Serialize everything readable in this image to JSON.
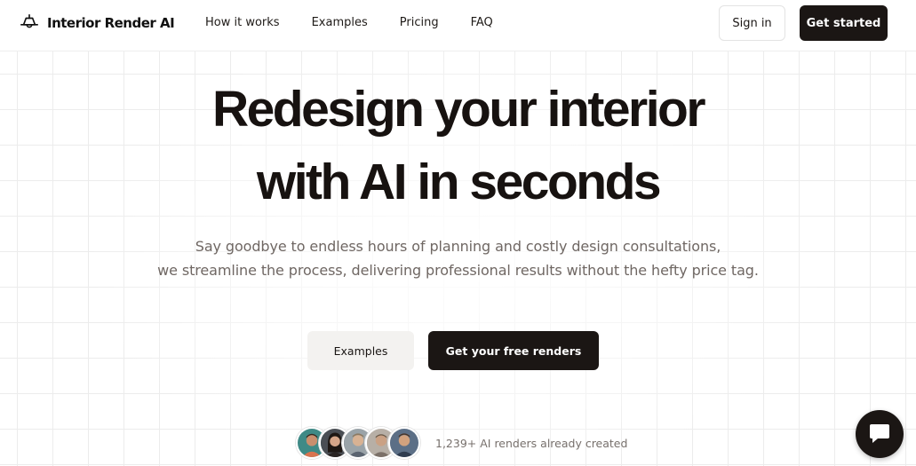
{
  "brand": {
    "name": "Interior Render AI",
    "icon": "lamp-icon"
  },
  "nav": {
    "items": [
      "How it works",
      "Examples",
      "Pricing",
      "FAQ"
    ]
  },
  "header_actions": {
    "signin_label": "Sign in",
    "get_started_label": "Get started"
  },
  "hero": {
    "title_line1": "Redesign your interior",
    "title_line2": "with AI in seconds",
    "subtitle_line1": "Say goodbye to endless hours of planning and costly design consultations,",
    "subtitle_line2": "we streamline the process, delivering professional results without the hefty price tag."
  },
  "cta": {
    "examples_label": "Examples",
    "free_renders_label": "Get your free renders"
  },
  "social_proof": {
    "text": "1,239+ AI renders already created",
    "avatar_count": 5
  },
  "chat": {
    "icon": "chat-bubble-icon"
  },
  "colors": {
    "primary": "#1b1614",
    "secondary_bg": "#f3f2f0",
    "muted_text": "#6f6763",
    "grid": "#ececec"
  }
}
